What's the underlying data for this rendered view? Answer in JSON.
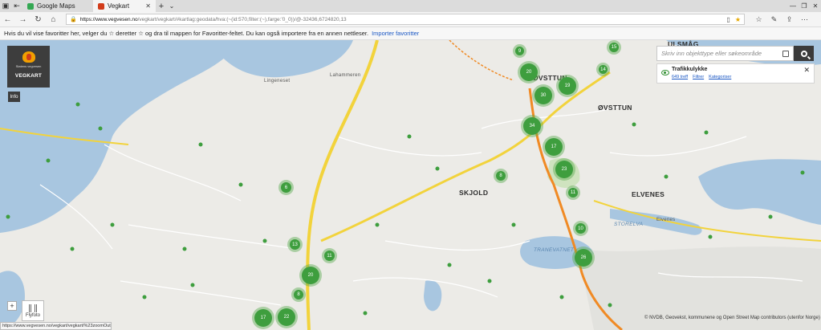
{
  "browser": {
    "tabs": [
      {
        "label": "Google Maps",
        "active": false,
        "favicon_color": "#34a853"
      },
      {
        "label": "Vegkart",
        "active": true,
        "favicon_color": "#d23c1a"
      }
    ],
    "address": {
      "url_host": "https://www.vegvesen.no",
      "url_tail": "/vegkart/vegkart/#kartlag:geodata/hva:(~(id:570,filter:(~),farge:'0_0))/@-32436,6724820,13",
      "favorite_star_color": "#e6a800"
    },
    "favorites_bar": {
      "message": "Hvis du vil vise favoritter her, velger du  ☆ deretter ☆ og dra til mappen for Favoritter-feltet. Du kan også importere fra en annen nettleser.",
      "import_link": "Importer favoritter"
    },
    "status_url": "https://www.vegvesen.no/vegkart/vegkart/%23zoomOut"
  },
  "app": {
    "org_name": "Statens vegvesen",
    "app_name": "VEGKART",
    "info_label": "Info",
    "search": {
      "placeholder": "Skriv inn objekttype eller søkeområde",
      "value": ""
    },
    "layer": {
      "title": "Trafikkulykke",
      "count": "649 treff",
      "filter": "Filtrer",
      "categories": "Kategoriser"
    },
    "zoom_label": "+",
    "flyfoto_label": "Flyfoto",
    "attribution": "© NVDB, Geovekst, kommunene og Open Street Map contributors (utenfor Norge)"
  },
  "map": {
    "places": [
      {
        "id": "ulsmag",
        "label": "ULSMÅG"
      },
      {
        "id": "ovsttun-n",
        "label": "ØVSTTUN"
      },
      {
        "id": "ovsttun",
        "label": "ØVSTTUN"
      },
      {
        "id": "skjold",
        "label": "SKJOLD"
      },
      {
        "id": "elvenes",
        "label": "ELVENES"
      },
      {
        "id": "lahammeren",
        "label": "Lahammeren"
      },
      {
        "id": "lingeneset",
        "label": "Lingeneset"
      },
      {
        "id": "elvenes-small",
        "label": "Elvenes"
      },
      {
        "id": "storelva",
        "label": "STORELVA"
      },
      {
        "id": "tranevatnet",
        "label": "TRANEVATNET"
      }
    ],
    "clusters": [
      {
        "label": "15"
      },
      {
        "label": "9"
      },
      {
        "label": "14"
      },
      {
        "label": "20"
      },
      {
        "label": "30"
      },
      {
        "label": "19"
      },
      {
        "label": "34"
      },
      {
        "label": "17"
      },
      {
        "label": "23"
      },
      {
        "label": "11"
      },
      {
        "label": "10"
      },
      {
        "label": "26"
      },
      {
        "label": "8"
      },
      {
        "label": "6"
      },
      {
        "label": "13"
      },
      {
        "label": "11"
      },
      {
        "label": "20"
      },
      {
        "label": "8"
      },
      {
        "label": "17"
      },
      {
        "label": "22"
      }
    ],
    "colors": {
      "water": "#a8c6e0",
      "road_major": "#f2d33c",
      "road_orange": "#f08a24",
      "cluster": "#3e9e3e"
    }
  }
}
